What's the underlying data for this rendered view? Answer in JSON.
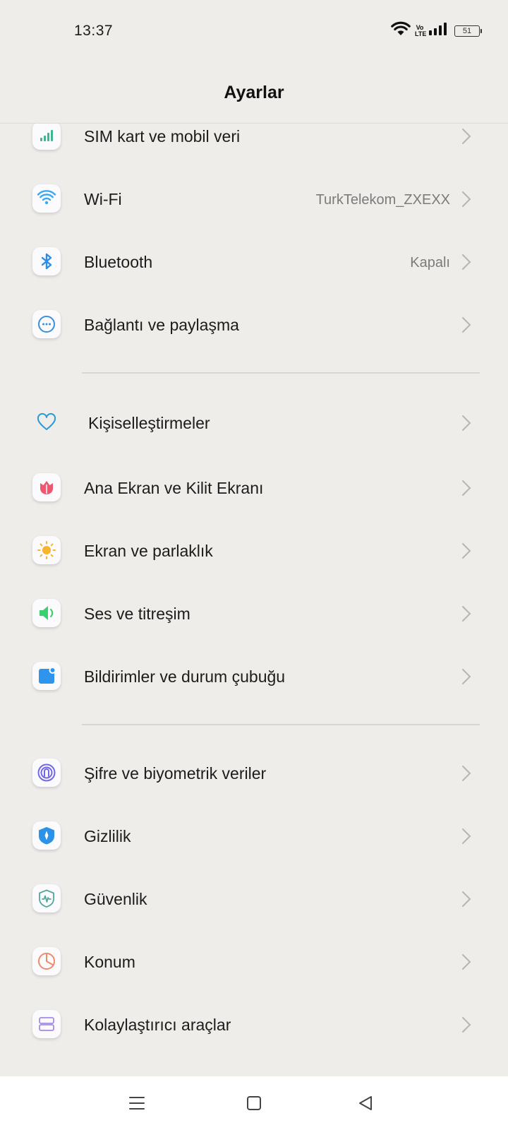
{
  "status_bar": {
    "time": "13:37",
    "network_label": "Vo\nLTE",
    "battery_level": "51"
  },
  "header": {
    "title": "Ayarlar"
  },
  "settings": {
    "sim": {
      "label": "SIM kart ve mobil veri",
      "icon": "signal-bars-icon",
      "color": "#3fb68f"
    },
    "wifi": {
      "label": "Wi-Fi",
      "value": "TurkTelekom_ZXEXX",
      "icon": "wifi-icon",
      "color": "#3aa7f0"
    },
    "bluetooth": {
      "label": "Bluetooth",
      "value": "Kapalı",
      "icon": "bluetooth-icon",
      "color": "#2b8de8"
    },
    "connection": {
      "label": "Bağlantı ve paylaşma",
      "icon": "more-circle-icon",
      "color": "#3b8fd8"
    },
    "personalization": {
      "label": "Kişiselleştirmeler",
      "icon": "heart-icon",
      "color": "#2a9ad9"
    },
    "home_lock": {
      "label": "Ana Ekran ve Kilit Ekranı",
      "icon": "tulip-icon",
      "color": "#f0566f"
    },
    "display": {
      "label": "Ekran ve parlaklık",
      "icon": "sun-icon",
      "color": "#f6b52c"
    },
    "sound": {
      "label": "Ses ve titreşim",
      "icon": "speaker-icon",
      "color": "#3ccf6f"
    },
    "notifications": {
      "label": "Bildirimler ve durum çubuğu",
      "icon": "notification-icon",
      "color": "#2f95ec"
    },
    "password": {
      "label": "Şifre ve biyometrik veriler",
      "icon": "fingerprint-icon",
      "color": "#7267e4"
    },
    "privacy": {
      "label": "Gizlilik",
      "icon": "privacy-shield-icon",
      "color": "#2b92e8"
    },
    "security": {
      "label": "Güvenlik",
      "icon": "security-shield-icon",
      "color": "#4fa99a"
    },
    "location": {
      "label": "Konum",
      "icon": "location-pie-icon",
      "color": "#ef8a6a"
    },
    "accessibility": {
      "label": "Kolaylaştırıcı araçlar",
      "icon": "accessibility-icon",
      "color": "#a58ae6"
    }
  }
}
